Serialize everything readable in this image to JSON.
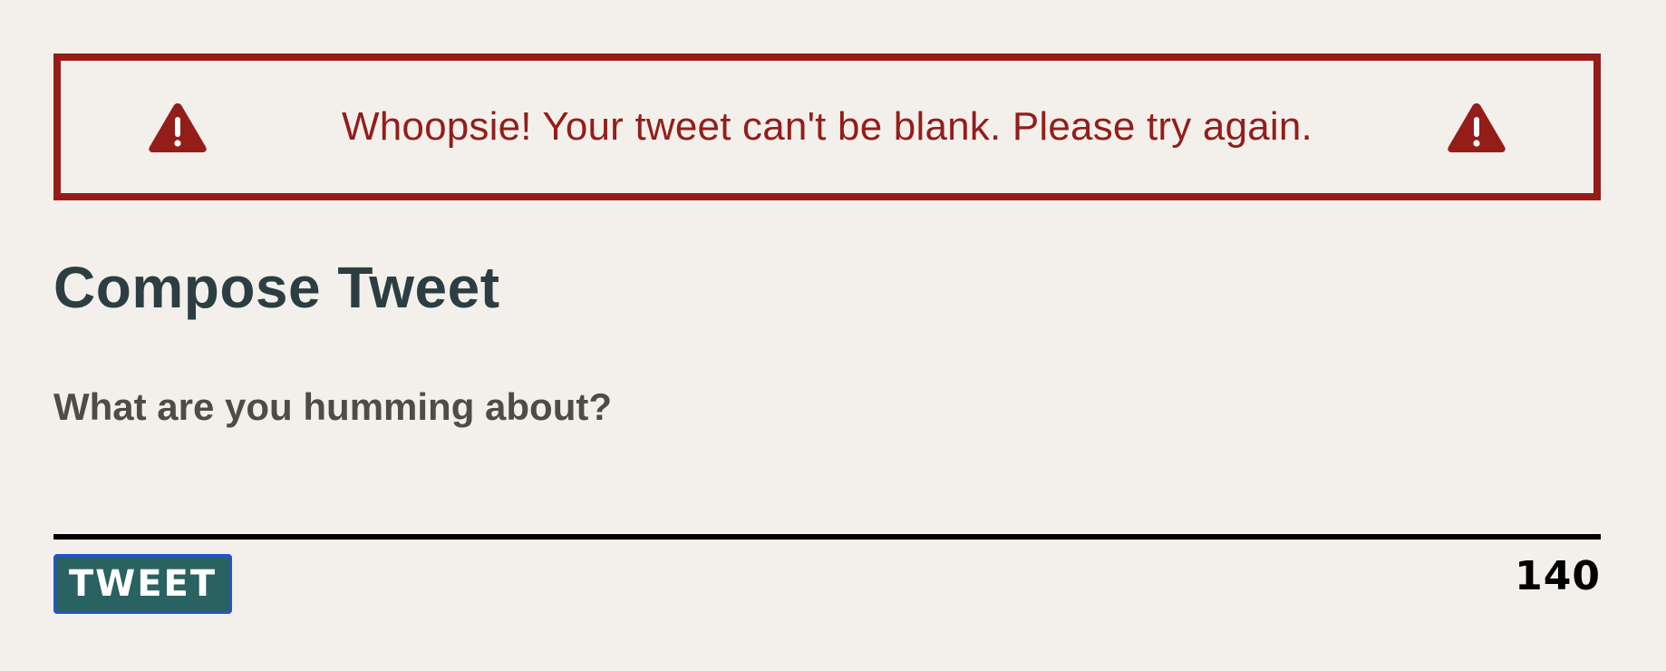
{
  "error": {
    "message": "Whoopsie! Your tweet can't be blank. Please try again.",
    "left_icon": "warning-triangle-icon",
    "right_icon": "warning-triangle-icon"
  },
  "page": {
    "title": "Compose Tweet"
  },
  "compose": {
    "prompt_label": "What are you humming about?",
    "input_value": "",
    "button_label": "TWEET",
    "char_count": "140"
  },
  "colors": {
    "background": "#f3f0eb",
    "error": "#941d1a",
    "title": "#2c3e42",
    "label": "#504b47",
    "button_bg": "#2a6161",
    "button_border": "#2553d0"
  }
}
